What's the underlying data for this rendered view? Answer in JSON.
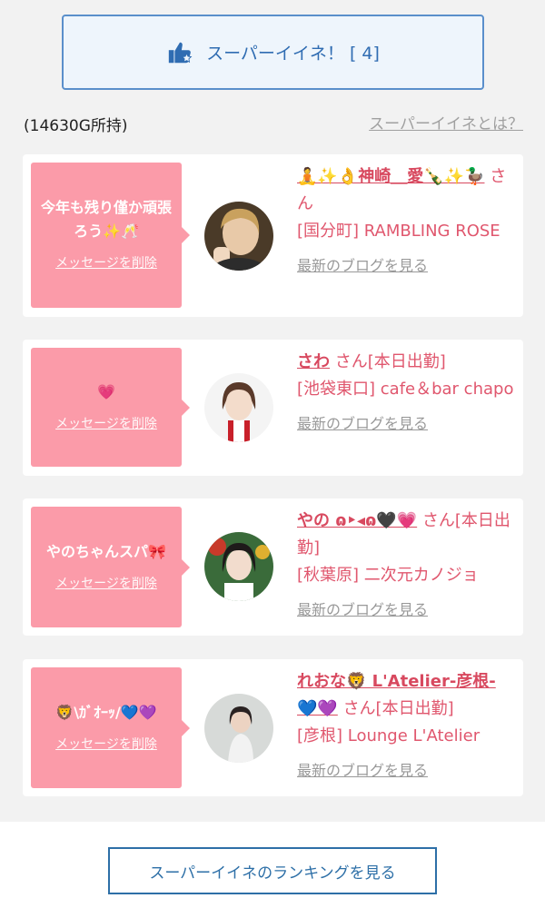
{
  "super_like_button": {
    "label": "スーパーイイネ！ [ 4]"
  },
  "owned_text": "(14630G所持)",
  "what_is_link": "スーパーイイネとは？",
  "cards": [
    {
      "message": "今年も残り僅か頑張ろう✨🥂",
      "delete_label": "メッセージを削除",
      "name": "🧘✨👌神崎＿愛🍾✨🦆",
      "san": "さん",
      "shop": "[国分町] RAMBLING ROSE",
      "blog": "最新のブログを見る"
    },
    {
      "message": "💗",
      "delete_label": "メッセージを削除",
      "name": "さわ",
      "san": "さん[本日出勤]",
      "shop": "[池袋東口] cafe＆bar chapo",
      "blog": "最新のブログを見る"
    },
    {
      "message": "やのちゃんスパ🎀",
      "delete_label": "メッセージを削除",
      "name": "やの ɷ‣◂ɷ🖤💗",
      "san": "さん[本日出勤]",
      "shop": "[秋葉原] 二次元カノジョ",
      "blog": "最新のブログを見る"
    },
    {
      "message": "🦁\\ｶﾞｵｰｯ/💙💜",
      "delete_label": "メッセージを削除",
      "name": "れおな🦁 L'Atelier-彦根-💙💜",
      "san": "さん[本日出勤]",
      "shop": "[彦根] Lounge L'Atelier",
      "blog": "最新のブログを見る"
    }
  ],
  "ranking_button": {
    "label": "スーパーイイネのランキングを見る"
  },
  "colors": {
    "accent_blue": "#2f6cb2",
    "bubble_pink": "#fb9ba9",
    "name_pink": "#d8495f"
  }
}
